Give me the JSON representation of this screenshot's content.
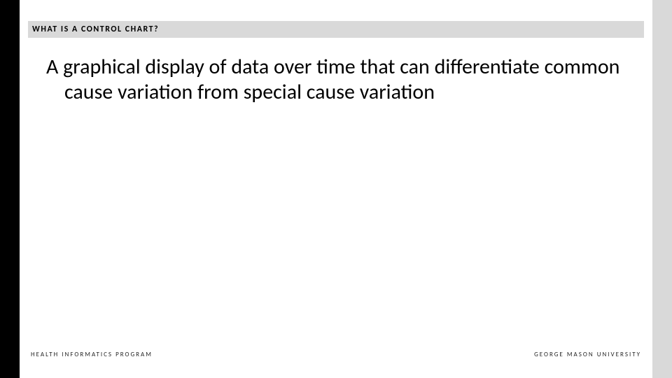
{
  "slide": {
    "title": "WHAT IS A CONTROL CHART?",
    "body": "A graphical display of data over time that can differentiate common cause variation from special cause variation",
    "footer_left": "HEALTH INFORMATICS PROGRAM",
    "footer_right": "GEORGE MASON UNIVERSITY"
  }
}
